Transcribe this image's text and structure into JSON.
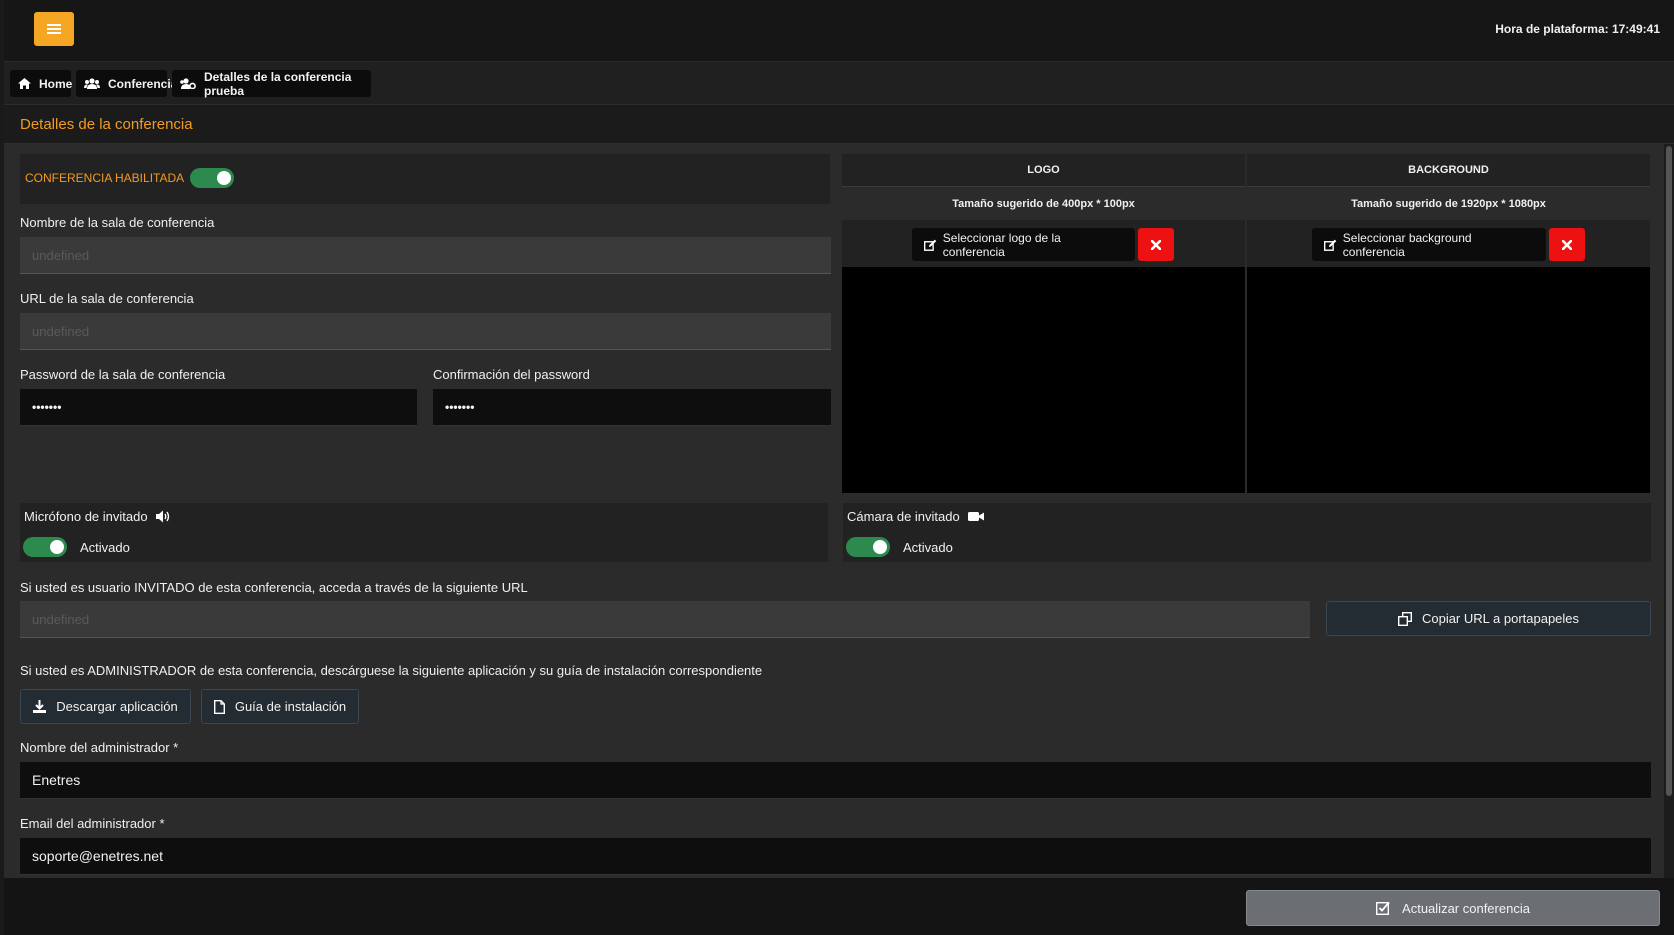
{
  "header": {
    "platform_time": "Hora de plataforma: 17:49:41"
  },
  "breadcrumb": [
    {
      "label": "Home",
      "icon": "home-icon"
    },
    {
      "label": "Conferencia",
      "icon": "users-icon"
    },
    {
      "label": "Detalles de la conferencia prueba",
      "icon": "users-cog-icon"
    }
  ],
  "page": {
    "title": "Detalles de la conferencia"
  },
  "form": {
    "enabled_label": "CONFERENCIA HABILITADA",
    "room_name_label": "Nombre de la sala de conferencia",
    "room_name_value": "undefined",
    "room_url_label": "URL de la sala de conferencia",
    "room_url_value": "undefined",
    "password_label": "Password de la sala de conferencia",
    "password_value": "•••••••",
    "password_confirm_label": "Confirmación del password",
    "password_confirm_value": "•••••••"
  },
  "media": {
    "logo": {
      "title": "LOGO",
      "size_hint": "Tamaño sugerido de 400px * 100px",
      "select_label": "Seleccionar logo de la conferencia"
    },
    "background": {
      "title": "BACKGROUND",
      "size_hint": "Tamaño sugerido de 1920px * 1080px",
      "select_label": "Seleccionar background conferencia"
    }
  },
  "guest": {
    "mic_label": "Micrófono de invitado",
    "mic_state": "Activado",
    "cam_label": "Cámara de invitado",
    "cam_state": "Activado"
  },
  "guest_url": {
    "info": "Si usted es usuario INVITADO de esta conferencia, acceda a través de la siguiente URL",
    "value": "undefined",
    "copy_label": "Copiar URL a portapapeles"
  },
  "admin": {
    "info": "Si usted es ADMINISTRADOR de esta conferencia, descárguese la siguiente aplicación y su guía de instalación correspondiente",
    "download_label": "Descargar aplicación",
    "guide_label": "Guía de instalación",
    "name_label": "Nombre del administrador *",
    "name_value": "Enetres",
    "email_label": "Email del administrador *",
    "email_value": "soporte@enetres.net"
  },
  "footer": {
    "update_label": "Actualizar conferencia"
  },
  "colors": {
    "accent": "#f39a21",
    "menu_button": "#f5a623",
    "toggle_on": "#2d8a4e",
    "delete": "#ee1111"
  }
}
